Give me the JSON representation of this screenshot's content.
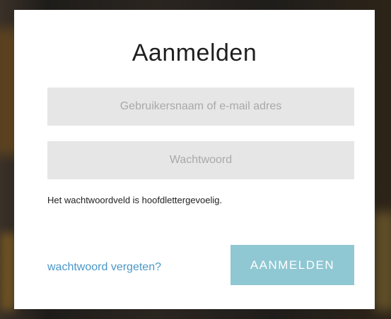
{
  "login_dialog": {
    "title": "Aanmelden",
    "username_field": {
      "placeholder": "Gebruikersnaam of e-mail adres",
      "value": ""
    },
    "password_field": {
      "placeholder": "Wachtwoord",
      "value": ""
    },
    "hint": "Het wachtwoordveld is hoofdlettergevoelig.",
    "forgot_link": "wachtwoord vergeten?",
    "submit_label": "AANMELDEN"
  },
  "colors": {
    "accent": "#8fc7d2",
    "link": "#4a97c8",
    "field_background": "#e6e6e6"
  }
}
